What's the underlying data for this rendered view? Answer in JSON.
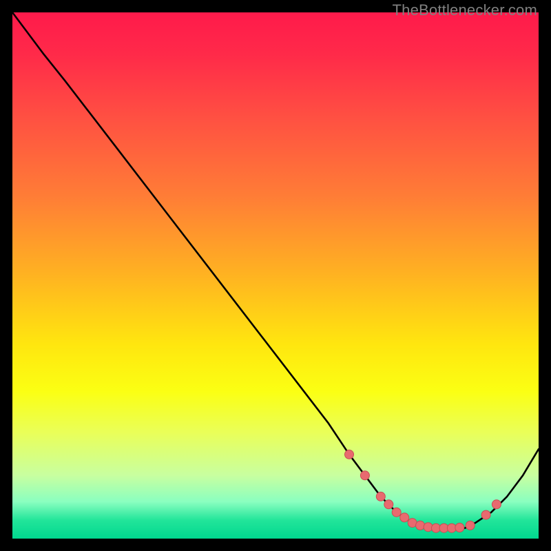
{
  "watermark": "TheBottlenecker.com",
  "colors": {
    "gradient_stops": [
      {
        "offset": 0.0,
        "color": "#ff1a4b"
      },
      {
        "offset": 0.08,
        "color": "#ff2a49"
      },
      {
        "offset": 0.2,
        "color": "#ff5042"
      },
      {
        "offset": 0.35,
        "color": "#ff7d36"
      },
      {
        "offset": 0.5,
        "color": "#ffb321"
      },
      {
        "offset": 0.63,
        "color": "#ffe60f"
      },
      {
        "offset": 0.72,
        "color": "#fbff13"
      },
      {
        "offset": 0.8,
        "color": "#e9ff5a"
      },
      {
        "offset": 0.88,
        "color": "#c8ffa0"
      },
      {
        "offset": 0.93,
        "color": "#8affc0"
      },
      {
        "offset": 0.965,
        "color": "#22e59a"
      },
      {
        "offset": 1.0,
        "color": "#00d88f"
      }
    ],
    "curve": "#000000",
    "marker_fill": "#e86a6f",
    "marker_stroke": "#c94d53"
  },
  "chart_data": {
    "type": "line",
    "title": "",
    "xlabel": "",
    "ylabel": "",
    "xlim": [
      0,
      100
    ],
    "ylim": [
      0,
      100
    ],
    "series": [
      {
        "name": "curve",
        "x": [
          0,
          6,
          10,
          20,
          30,
          40,
          50,
          60,
          64,
          67,
          70,
          73,
          76,
          80,
          83,
          86,
          88,
          91,
          94,
          97,
          100
        ],
        "y": [
          100,
          92,
          87,
          74,
          61,
          48,
          35,
          22,
          16,
          12,
          8,
          5,
          3,
          2,
          2,
          2,
          3,
          5,
          8,
          12,
          17
        ]
      }
    ],
    "markers": {
      "name": "highlighted-points",
      "x": [
        64,
        67,
        70,
        71.5,
        73,
        74.5,
        76,
        77.5,
        79,
        80.5,
        82,
        83.5,
        85,
        87,
        90,
        92
      ],
      "y": [
        16,
        12,
        8,
        6.5,
        5,
        4,
        3,
        2.5,
        2.2,
        2.0,
        2.0,
        2.0,
        2.1,
        2.5,
        4.5,
        6.5
      ]
    }
  }
}
